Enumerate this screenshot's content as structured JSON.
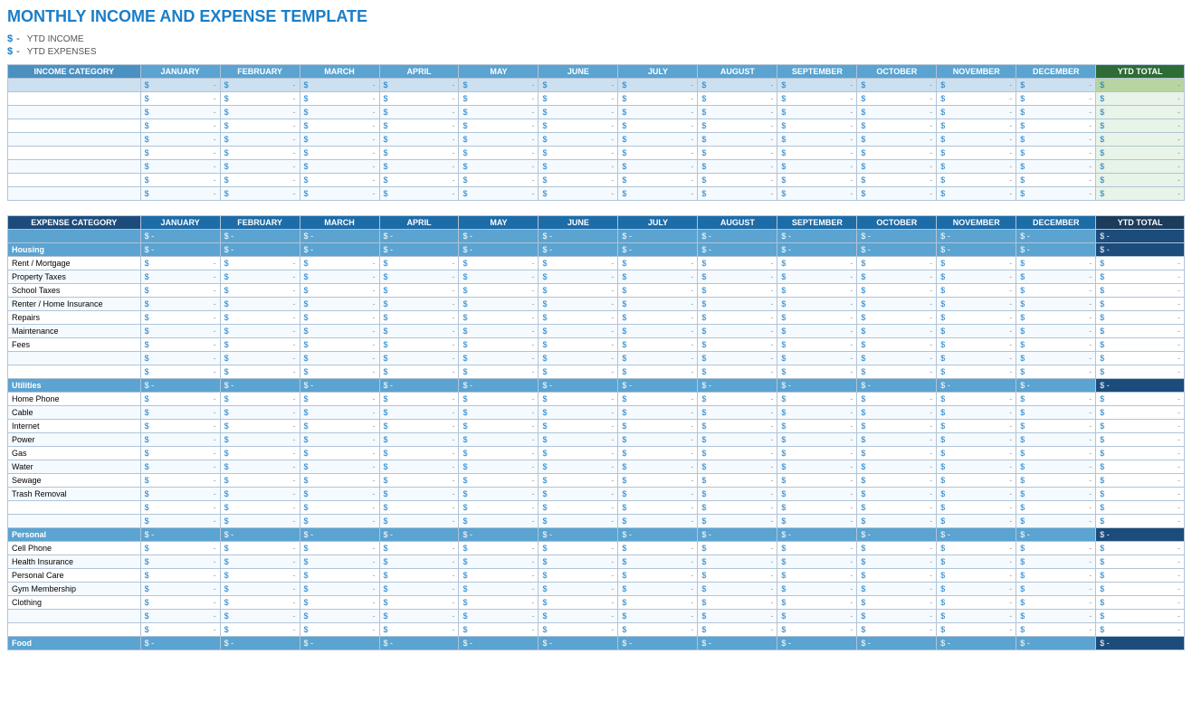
{
  "title": "MONTHLY INCOME AND EXPENSE TEMPLATE",
  "ytd_income": {
    "label": "YTD INCOME",
    "value": "$",
    "dash": "-"
  },
  "ytd_expenses": {
    "label": "YTD EXPENSES",
    "value": "$",
    "dash": "-"
  },
  "months": [
    "JANUARY",
    "FEBRUARY",
    "MARCH",
    "APRIL",
    "MAY",
    "JUNE",
    "JULY",
    "AUGUST",
    "SEPTEMBER",
    "OCTOBER",
    "NOVEMBER",
    "DECEMBER"
  ],
  "income_table": {
    "cat_header": "INCOME CATEGORY",
    "ytd_header": "YTD TOTAL",
    "total_row_label": "",
    "data_rows": 8
  },
  "expense_table": {
    "cat_header": "EXPENSE CATEGORY",
    "ytd_header": "YTD TOTAL",
    "sections": [
      {
        "name": "Housing",
        "items": [
          "Rent / Mortgage",
          "Property Taxes",
          "School Taxes",
          "Renter / Home Insurance",
          "Repairs",
          "Maintenance",
          "Fees",
          "",
          ""
        ]
      },
      {
        "name": "Utilities",
        "items": [
          "Home Phone",
          "Cable",
          "Internet",
          "Power",
          "Gas",
          "Water",
          "Sewage",
          "Trash Removal",
          "",
          ""
        ]
      },
      {
        "name": "Personal",
        "items": [
          "Cell Phone",
          "Health Insurance",
          "Personal Care",
          "Gym Membership",
          "Clothing",
          "",
          ""
        ]
      },
      {
        "name": "Food",
        "items": []
      }
    ]
  }
}
